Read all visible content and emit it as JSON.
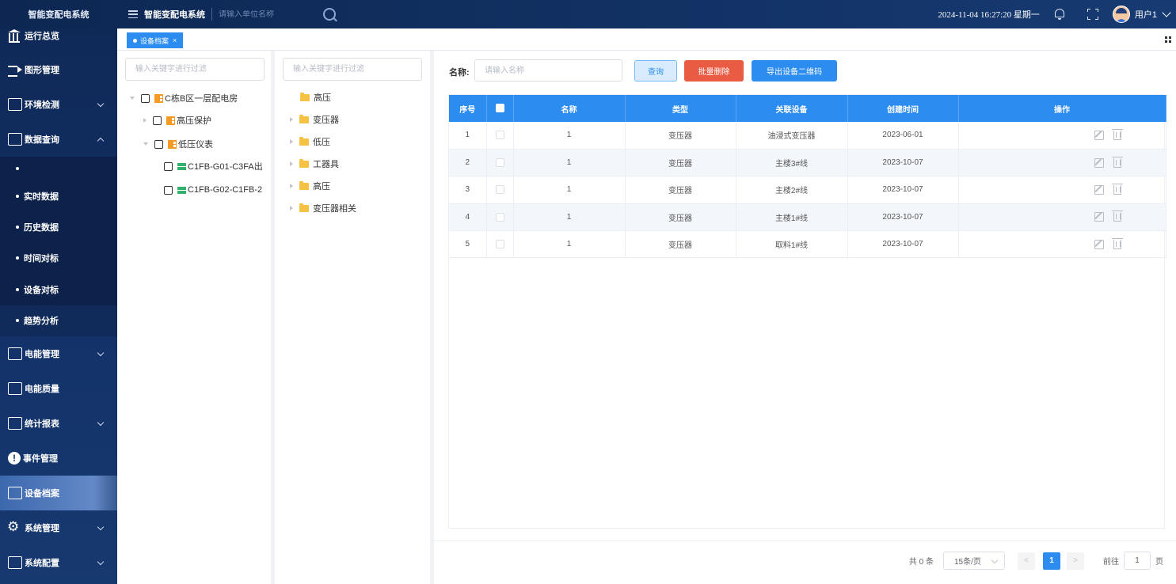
{
  "header": {
    "brand": "智能变配电系统",
    "title": "智能变配电系统",
    "unit_search_placeholder": "请输入单位名称",
    "datetime": "2024-11-04 16:27:20 星期一",
    "user": "用户1"
  },
  "sidebar": {
    "items": [
      {
        "label": "运行总览",
        "icon": "bank-icon"
      },
      {
        "label": "图形管理",
        "icon": "arrow-icon"
      },
      {
        "label": "环境检测",
        "icon": "list-icon"
      },
      {
        "label": "数据查询",
        "icon": "chart-icon"
      },
      {
        "label": "电能管理",
        "icon": "power-icon"
      },
      {
        "label": "电能质量",
        "icon": "quality-icon"
      },
      {
        "label": "统计报表",
        "icon": "report-icon"
      },
      {
        "label": "事件管理",
        "icon": "alert-icon"
      },
      {
        "label": "设备档案",
        "icon": "archive-icon"
      },
      {
        "label": "系统管理",
        "icon": "gear-icon"
      },
      {
        "label": "系统配置",
        "icon": "monitor-icon"
      }
    ],
    "submenu": [
      "实时数据",
      "历史数据",
      "时间对标",
      "设备对标",
      "趋势分析"
    ],
    "active": "设备档案"
  },
  "tabs": [
    {
      "label": "设备档案",
      "close": "×"
    }
  ],
  "tree1": {
    "placeholder": "输入关键字进行过滤",
    "nodes": [
      "C栋B区一层配电房",
      "高压保护",
      "低压仪表",
      "C1FB-G01-C3FA出",
      "C1FB-G02-C1FB-2"
    ]
  },
  "tree2": {
    "placeholder": "输入关键字进行过滤",
    "nodes": [
      "高压",
      "变压器",
      "低压",
      "工器具",
      "高压",
      "变压器相关"
    ]
  },
  "query": {
    "label": "名称:",
    "placeholder": "请输入名称",
    "btn_query": "查询",
    "btn_batch_delete": "批量删除",
    "btn_export_qr": "导出设备二维码"
  },
  "table": {
    "columns": [
      "序号",
      "名称",
      "类型",
      "关联设备",
      "创建时间",
      "操作"
    ],
    "rows": [
      {
        "idx": "1",
        "name": "1",
        "type": "变压器",
        "device": "油浸式变压器",
        "created": "2023-06-01"
      },
      {
        "idx": "2",
        "name": "1",
        "type": "变压器",
        "device": "主楼3#线",
        "created": "2023-10-07"
      },
      {
        "idx": "3",
        "name": "1",
        "type": "变压器",
        "device": "主楼2#线",
        "created": "2023-10-07"
      },
      {
        "idx": "4",
        "name": "1",
        "type": "变压器",
        "device": "主楼1#线",
        "created": "2023-10-07"
      },
      {
        "idx": "5",
        "name": "1",
        "type": "变压器",
        "device": "取料1#线",
        "created": "2023-10-07"
      }
    ]
  },
  "pagination": {
    "total": "共 0 条",
    "page_size": "15条/页",
    "prev": "<",
    "current": "1",
    "next": ">",
    "goto_label": "前往",
    "goto_value": "1",
    "page_unit": "页"
  }
}
